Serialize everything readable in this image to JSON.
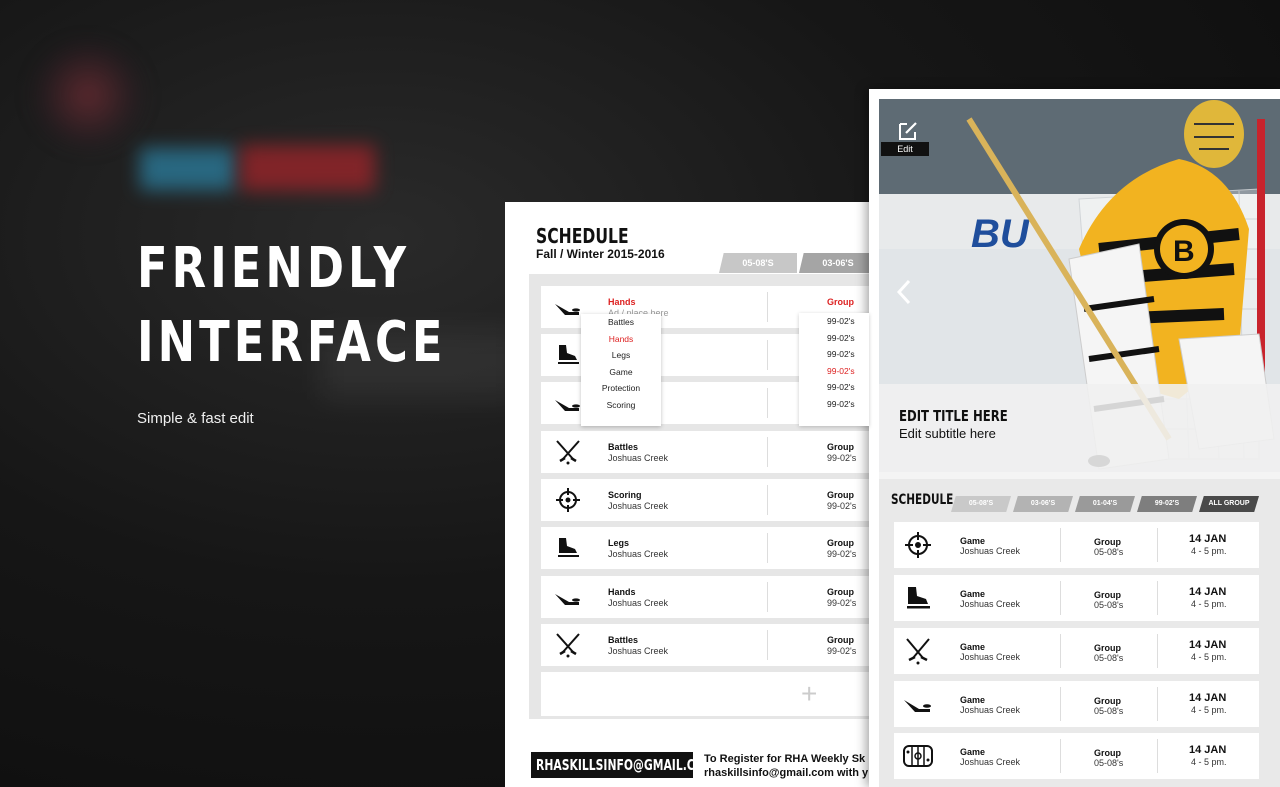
{
  "hero": {
    "title_line1": "FRIENDLY",
    "title_line2": "INTERFACE",
    "subtitle": "Simple & fast edit"
  },
  "left_card": {
    "title": "SCHEDULE",
    "season": "Fall / Winter 2015-2016",
    "tabs": [
      "05-08'S",
      "03-06'S"
    ],
    "rows": [
      {
        "icon": "stick-puck-icon",
        "label": "Hands",
        "sub": "Ad / place here",
        "group_label": "Group",
        "group": ""
      },
      {
        "icon": "skate-icon",
        "label": "",
        "sub": "",
        "group_label": "",
        "group": ""
      },
      {
        "icon": "stick-puck-icon",
        "label": "",
        "sub": "",
        "group_label": "",
        "group": ""
      },
      {
        "icon": "crossed-sticks-icon",
        "label": "Battles",
        "sub": "Joshuas Creek",
        "group_label": "Group",
        "group": "99-02's"
      },
      {
        "icon": "target-icon",
        "label": "Scoring",
        "sub": "Joshuas Creek",
        "group_label": "Group",
        "group": "99-02's"
      },
      {
        "icon": "skate-icon",
        "label": "Legs",
        "sub": "Joshuas Creek",
        "group_label": "Group",
        "group": "99-02's"
      },
      {
        "icon": "stick-puck-icon",
        "label": "Hands",
        "sub": "Joshuas Creek",
        "group_label": "Group",
        "group": "99-02's"
      },
      {
        "icon": "crossed-sticks-icon",
        "label": "Battles",
        "sub": "Joshuas Creek",
        "group_label": "Group",
        "group": "99-02's"
      }
    ],
    "add_symbol": "+",
    "category_dropdown": [
      "Battles",
      "Hands",
      "Legs",
      "Game",
      "Protection",
      "Scoring"
    ],
    "category_selected": "Hands",
    "group_dropdown": [
      "99-02's",
      "99-02's",
      "99-02's",
      "99-02's",
      "99-02's",
      "99-02's"
    ],
    "group_selected_index": 3,
    "footer_email": "RHASKILLSINFO@GMAIL.COM",
    "footer_line1": "To Register for RHA Weekly Sk",
    "footer_line2": "rhaskillsinfo@gmail.com with y"
  },
  "right_card": {
    "edit_label": "Edit",
    "hero_title": "EDIT TITLE HERE",
    "hero_subtitle": "Edit subtitle here",
    "schedule_title": "SCHEDULE",
    "tabs": [
      {
        "label": "05-08'S",
        "color": "#c9c9c9"
      },
      {
        "label": "03-06'S",
        "color": "#b3b3b3"
      },
      {
        "label": "01-04'S",
        "color": "#9a9a9a"
      },
      {
        "label": "99-02'S",
        "color": "#7e7e7e"
      },
      {
        "label": "ALL GROUP",
        "color": "#4a4a4a"
      }
    ],
    "rows": [
      {
        "icon": "target-icon",
        "event": "Game",
        "location": "Joshuas Creek",
        "group_label": "Group",
        "group": "05-08's",
        "date": "14 JAN",
        "time": "4 - 5 pm."
      },
      {
        "icon": "skate-icon",
        "event": "Game",
        "location": "Joshuas Creek",
        "group_label": "Group",
        "group": "05-08's",
        "date": "14 JAN",
        "time": "4 - 5 pm."
      },
      {
        "icon": "crossed-sticks-icon",
        "event": "Game",
        "location": "Joshuas Creek",
        "group_label": "Group",
        "group": "05-08's",
        "date": "14 JAN",
        "time": "4 - 5 pm."
      },
      {
        "icon": "stick-puck-icon",
        "event": "Game",
        "location": "Joshuas Creek",
        "group_label": "Group",
        "group": "05-08's",
        "date": "14 JAN",
        "time": "4 - 5 pm."
      },
      {
        "icon": "rink-icon",
        "event": "Game",
        "location": "Joshuas Creek",
        "group_label": "Group",
        "group": "05-08's",
        "date": "14 JAN",
        "time": "4 - 5 pm."
      }
    ]
  },
  "colors": {
    "accent_red": "#dd2222",
    "dark": "#111111",
    "panel_gray": "#e6e6e6"
  }
}
